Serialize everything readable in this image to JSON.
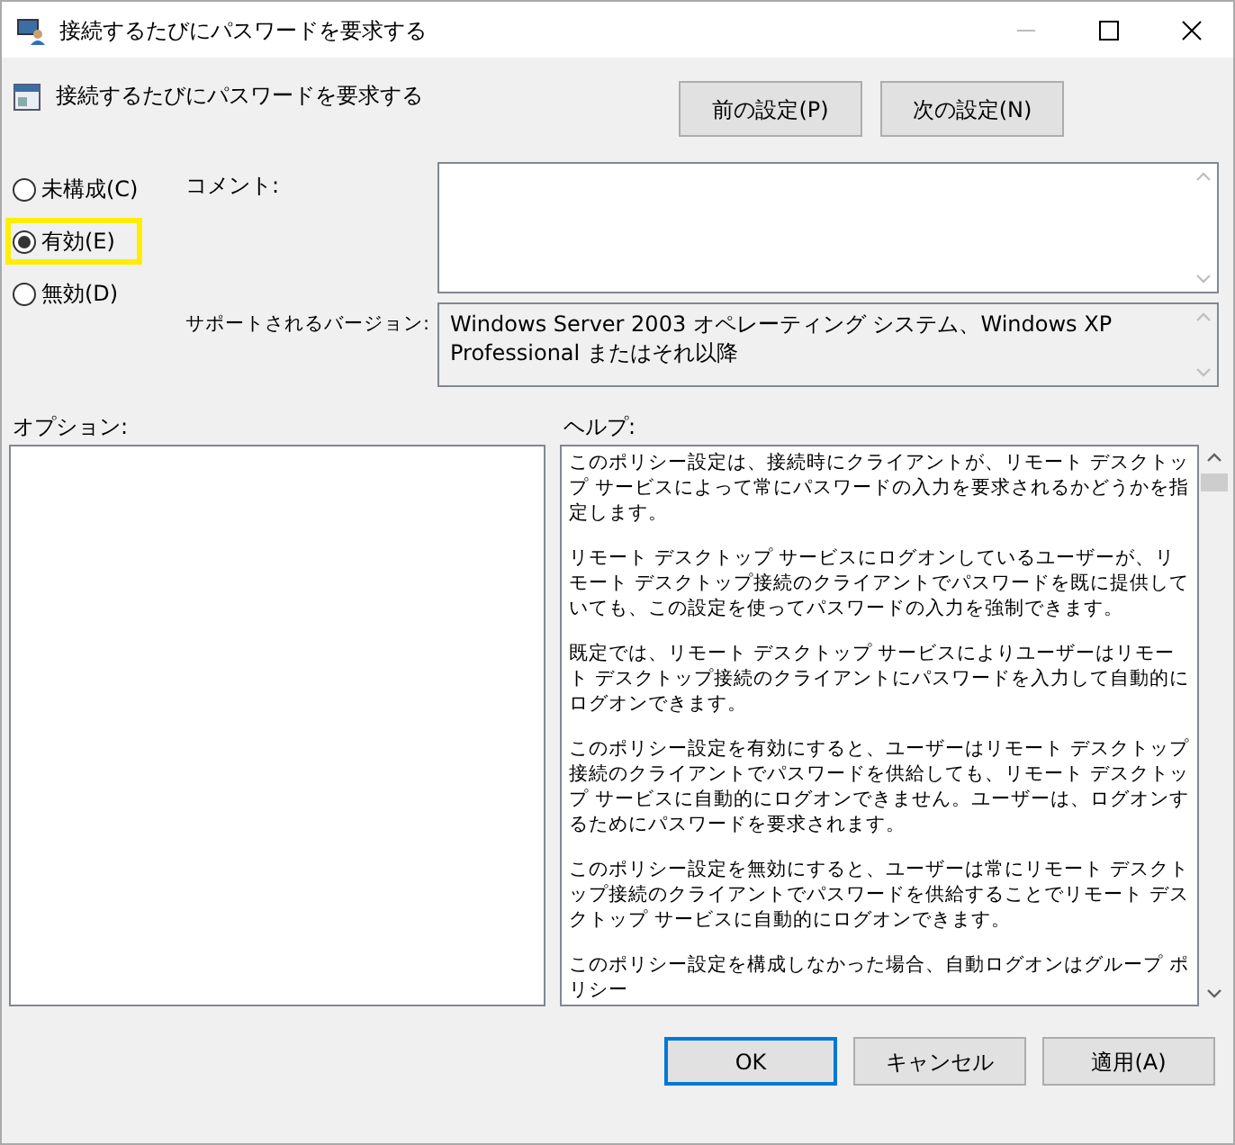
{
  "window": {
    "title": "接続するたびにパスワードを要求する"
  },
  "policy_title": "接続するたびにパスワードを要求する",
  "nav_buttons": [
    "前の設定(P)",
    "次の設定(N)"
  ],
  "radios": [
    {
      "label": "未構成(C)",
      "selected": false,
      "highlighted": false
    },
    {
      "label": "有効(E)",
      "selected": true,
      "highlighted": true
    },
    {
      "label": "無効(D)",
      "selected": false,
      "highlighted": false
    }
  ],
  "comment": {
    "label": "コメント:"
  },
  "supported": {
    "label": "サポートされるバージョン:",
    "value": "Windows Server 2003 オペレーティング システム、Windows XP Professional またはそれ以降"
  },
  "options": {
    "label": "オプション:"
  },
  "help": {
    "label": "ヘルプ:",
    "paragraphs": [
      "このポリシー設定は、接続時にクライアントが、リモート デスクトップ サービスによって常にパスワードの入力を要求されるかどうかを指定します。",
      "リモート デスクトップ サービスにログオンしているユーザーが、リモート デスクトップ接続のクライアントでパスワードを既に提供していても、この設定を使ってパスワードの入力を強制できます。",
      "既定では、リモート デスクトップ サービスによりユーザーはリモート デスクトップ接続のクライアントにパスワードを入力して自動的にログオンできます。",
      "このポリシー設定を有効にすると、ユーザーはリモート デスクトップ接続のクライアントでパスワードを供給しても、リモート デスクトップ サービスに自動的にログオンできません。ユーザーは、ログオンするためにパスワードを要求されます。",
      "このポリシー設定を無効にすると、ユーザーは常にリモート デスクトップ接続のクライアントでパスワードを供給することでリモート デスクトップ サービスに自動的にログオンできます。",
      "このポリシー設定を構成しなかった場合、自動ログオンはグループ ポリシー"
    ]
  },
  "footer_buttons": [
    {
      "label": "OK",
      "default": true
    },
    {
      "label": "キャンセル",
      "default": false
    },
    {
      "label": "適用(A)",
      "default": false
    }
  ]
}
